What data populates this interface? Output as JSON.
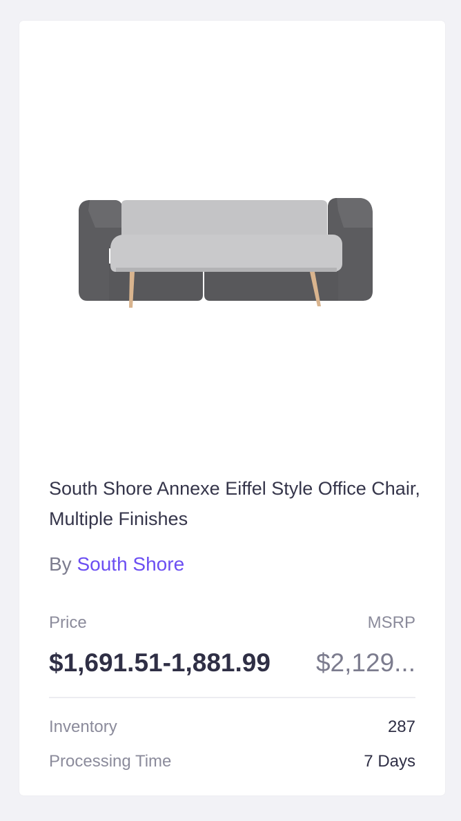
{
  "product": {
    "image_alt": "product-image-sofa",
    "title": "South Shore Annexe Eiffel Style Office Chair, Multiple Finishes",
    "brand_prefix": "By ",
    "brand_name": "South Shore"
  },
  "pricing": {
    "price_label": "Price",
    "price_value": "$1,691.51-1,881.99",
    "msrp_label": "MSRP",
    "msrp_value": "$2,129..."
  },
  "details": {
    "inventory_label": "Inventory",
    "inventory_value": "287",
    "processing_label": "Processing Time",
    "processing_value": "7 Days"
  },
  "colors": {
    "background": "#f2f2f6",
    "card": "#ffffff",
    "title_text": "#35354a",
    "brand_link": "#6b4ef2",
    "muted_text": "#8b8b9b",
    "strong_text": "#2f2f45",
    "divider": "#ececf1"
  }
}
